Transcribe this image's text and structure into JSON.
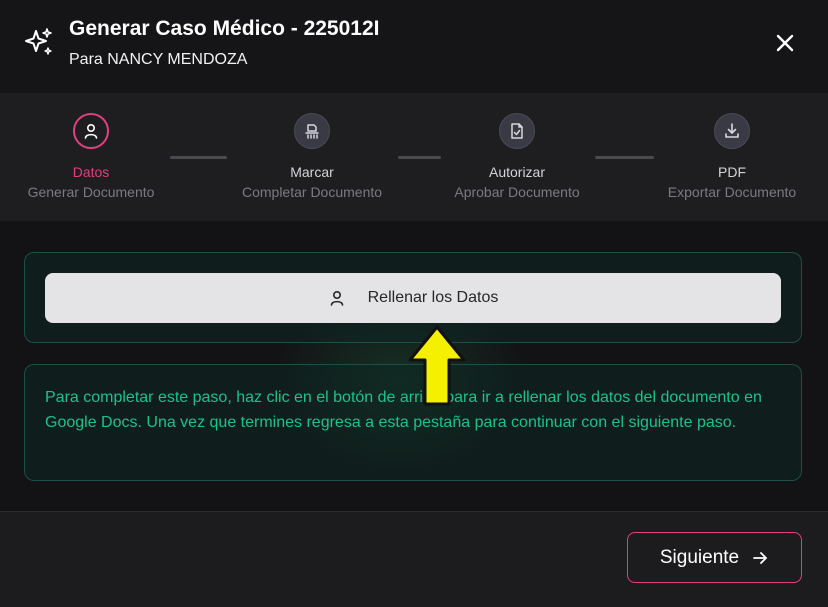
{
  "header": {
    "title": "Generar Caso Médico - 225012I",
    "subtitle": "Para NANCY MENDOZA",
    "icon": "sparkles-icon",
    "close_icon": "close-icon"
  },
  "steps": [
    {
      "label": "Datos",
      "description": "Generar Documento",
      "icon": "user-icon",
      "active": true
    },
    {
      "label": "Marcar",
      "description": "Completar Documento",
      "icon": "stamp-icon",
      "active": false
    },
    {
      "label": "Autorizar",
      "description": "Aprobar Documento",
      "icon": "file-check-icon",
      "active": false
    },
    {
      "label": "PDF",
      "description": "Exportar Documento",
      "icon": "download-icon",
      "active": false
    }
  ],
  "main": {
    "fill_button_label": "Rellenar los Datos",
    "info_text": "Para completar este paso, haz clic en el botón de arriba para ir a rellenar los datos del documento en Google Docs. Una vez que termines regresa a esta pestaña para continuar con el siguiente paso."
  },
  "footer": {
    "next_label": "Siguiente"
  },
  "colors": {
    "accent": "#e0407e",
    "info_text": "#19c38a",
    "annotation_arrow": "#f5ef00"
  }
}
